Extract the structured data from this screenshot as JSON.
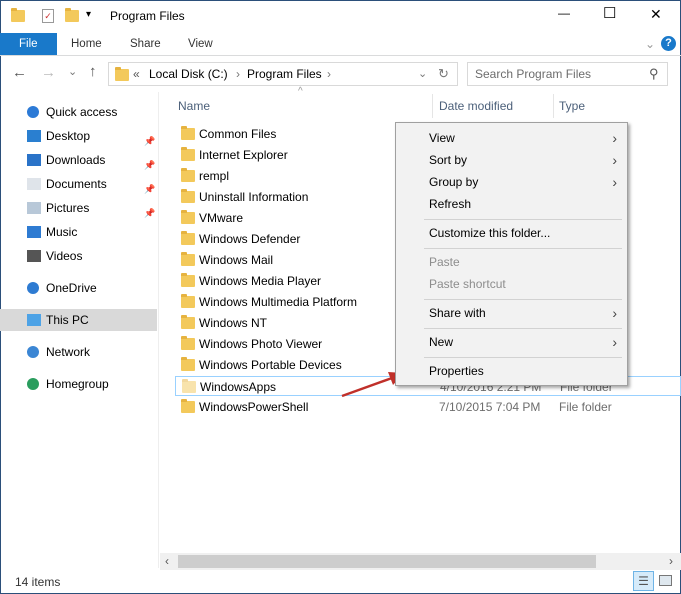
{
  "window": {
    "title": "Program Files",
    "minimize": "—",
    "maximize": "☐",
    "close": "✕"
  },
  "ribbon": {
    "tabs": [
      "File",
      "Home",
      "Share",
      "View"
    ],
    "help": "?",
    "expand": "⌄"
  },
  "address": {
    "back": "←",
    "forward": "→",
    "recent": "⌄",
    "up": "↑",
    "overflow": "«",
    "crumbs": [
      "Local Disk (C:)",
      "Program Files"
    ],
    "sep": "›",
    "dropdown": "⌄",
    "refresh": "↻",
    "search_placeholder": "Search Program Files",
    "search_icon": "⚲"
  },
  "nav": {
    "items": [
      {
        "label": "Quick access",
        "icon": "star-icon",
        "pinned": false
      },
      {
        "label": "Desktop",
        "icon": "desktop-icon",
        "pinned": true
      },
      {
        "label": "Downloads",
        "icon": "download-icon",
        "pinned": true
      },
      {
        "label": "Documents",
        "icon": "documents-icon",
        "pinned": true
      },
      {
        "label": "Pictures",
        "icon": "pictures-icon",
        "pinned": true
      },
      {
        "label": "Music",
        "icon": "music-icon",
        "pinned": false
      },
      {
        "label": "Videos",
        "icon": "videos-icon",
        "pinned": false
      },
      {
        "label": "OneDrive",
        "icon": "cloud-icon",
        "pinned": false
      },
      {
        "label": "This PC",
        "icon": "computer-icon",
        "pinned": false,
        "selected": true
      },
      {
        "label": "Network",
        "icon": "network-icon",
        "pinned": false
      },
      {
        "label": "Homegroup",
        "icon": "homegroup-icon",
        "pinned": false
      }
    ]
  },
  "columns": {
    "name": "Name",
    "date": "Date modified",
    "type": "Type",
    "sort": "^"
  },
  "files": [
    {
      "name": "Common Files",
      "date": "",
      "type": ""
    },
    {
      "name": "Internet Explorer",
      "date": "",
      "type": ""
    },
    {
      "name": "rempl",
      "date": "",
      "type": ""
    },
    {
      "name": "Uninstall Information",
      "date": "",
      "type": ""
    },
    {
      "name": "VMware",
      "date": "",
      "type": ""
    },
    {
      "name": "Windows Defender",
      "date": "",
      "type": ""
    },
    {
      "name": "Windows Mail",
      "date": "",
      "type": ""
    },
    {
      "name": "Windows Media Player",
      "date": "",
      "type": ""
    },
    {
      "name": "Windows Multimedia Platform",
      "date": "",
      "type": ""
    },
    {
      "name": "Windows NT",
      "date": "",
      "type": ""
    },
    {
      "name": "Windows Photo Viewer",
      "date": "",
      "type": ""
    },
    {
      "name": "Windows Portable Devices",
      "date": "",
      "type": ""
    },
    {
      "name": "WindowsApps",
      "date": "4/10/2016 2:21 PM",
      "type": "File folder",
      "selected": true
    },
    {
      "name": "WindowsPowerShell",
      "date": "7/10/2015 7:04 PM",
      "type": "File folder"
    }
  ],
  "context_menu": {
    "items": [
      {
        "label": "View",
        "submenu": true
      },
      {
        "label": "Sort by",
        "submenu": true
      },
      {
        "label": "Group by",
        "submenu": true
      },
      {
        "label": "Refresh"
      },
      {
        "label": "Customize this folder..."
      },
      {
        "label": "Paste",
        "disabled": true
      },
      {
        "label": "Paste shortcut",
        "disabled": true
      },
      {
        "label": "Share with",
        "submenu": true
      },
      {
        "label": "New",
        "submenu": true
      },
      {
        "label": "Properties"
      }
    ],
    "arrow": "›"
  },
  "status": {
    "count": "14 items"
  },
  "colors": {
    "accent": "#1979ca",
    "selected_nav": "#d9d9d9",
    "annotation_arrow": "#c0302a"
  }
}
